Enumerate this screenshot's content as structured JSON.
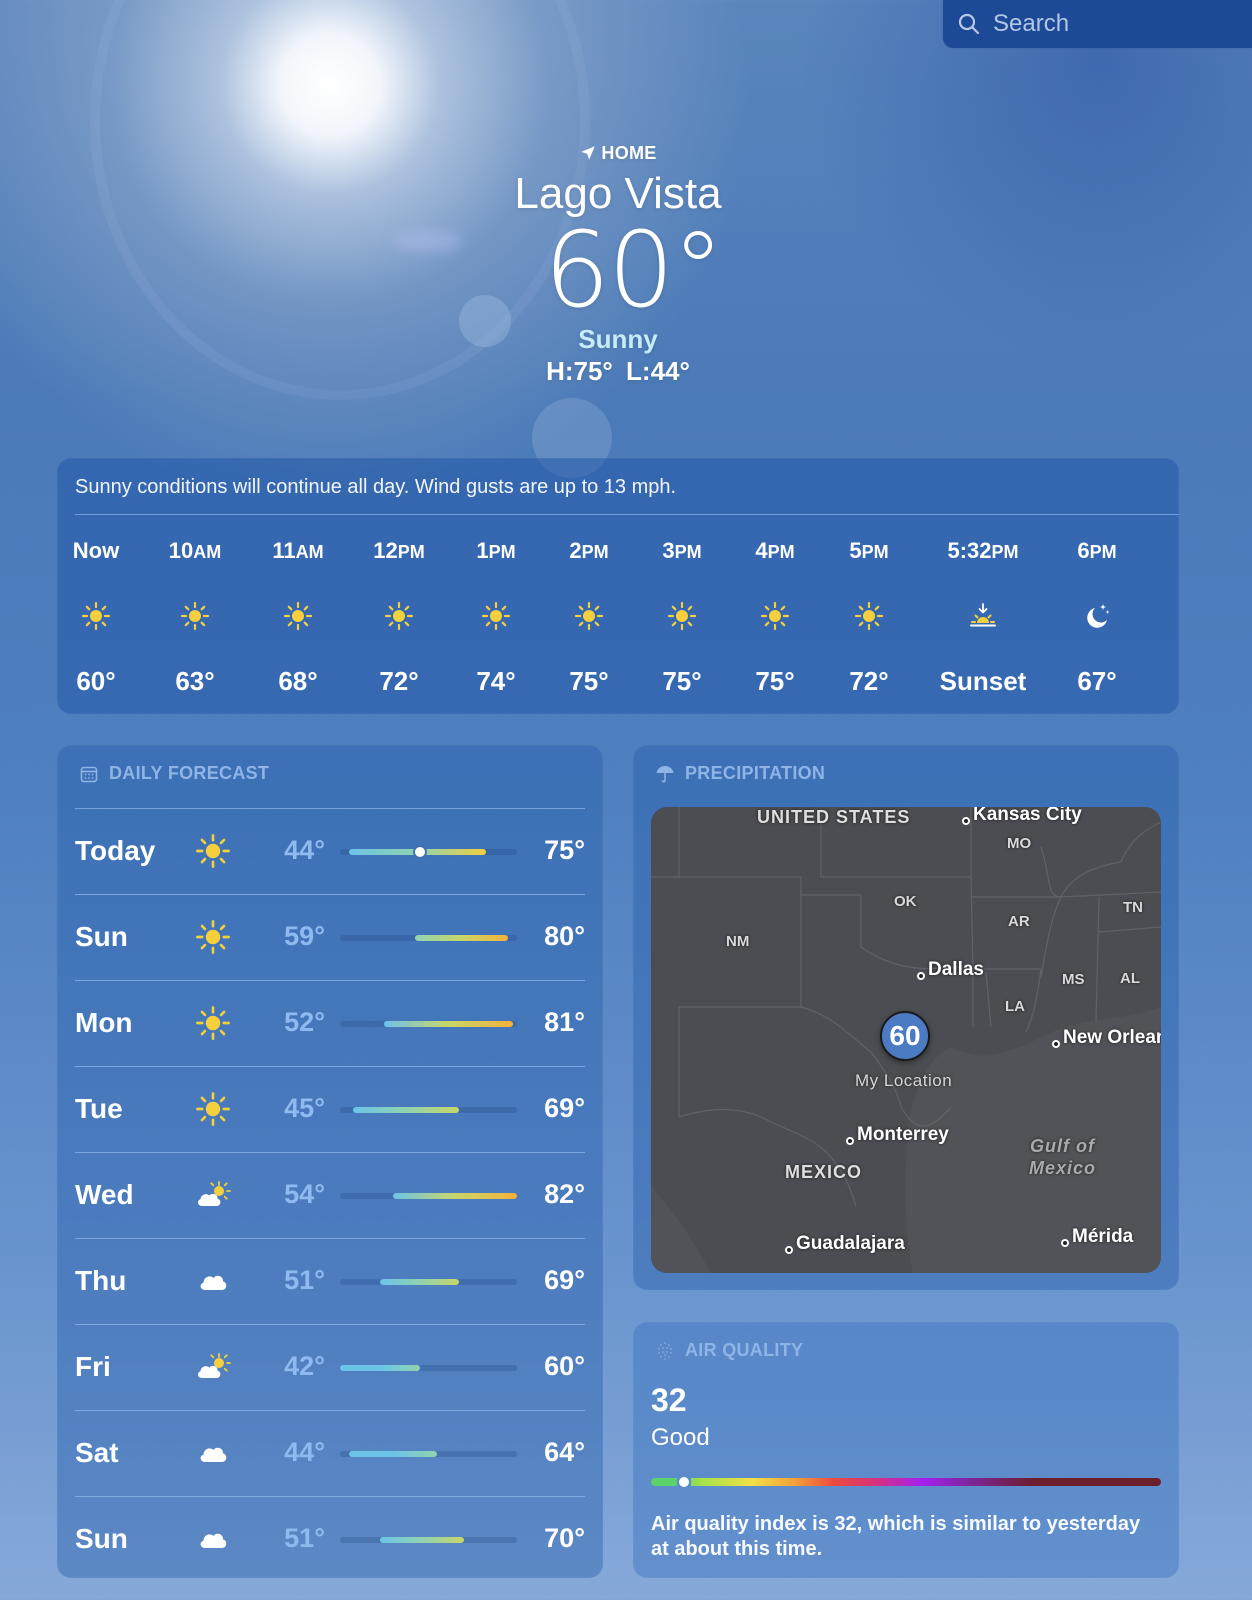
{
  "search": {
    "placeholder": "Search"
  },
  "header": {
    "home_label": "HOME",
    "city": "Lago Vista",
    "temperature": "60°",
    "condition": "Sunny",
    "high_low": "H:75°  L:44°"
  },
  "hourly": {
    "summary": "Sunny conditions will continue all day. Wind gusts are up to 13 mph.",
    "hours": [
      {
        "time": "Now",
        "suffix": "",
        "icon": "sun-icon",
        "value": "60°"
      },
      {
        "time": "10",
        "suffix": "AM",
        "icon": "sun-icon",
        "value": "63°"
      },
      {
        "time": "11",
        "suffix": "AM",
        "icon": "sun-icon",
        "value": "68°"
      },
      {
        "time": "12",
        "suffix": "PM",
        "icon": "sun-icon",
        "value": "72°"
      },
      {
        "time": "1",
        "suffix": "PM",
        "icon": "sun-icon",
        "value": "74°"
      },
      {
        "time": "2",
        "suffix": "PM",
        "icon": "sun-icon",
        "value": "75°"
      },
      {
        "time": "3",
        "suffix": "PM",
        "icon": "sun-icon",
        "value": "75°"
      },
      {
        "time": "4",
        "suffix": "PM",
        "icon": "sun-icon",
        "value": "75°"
      },
      {
        "time": "5",
        "suffix": "PM",
        "icon": "sun-icon",
        "value": "72°"
      },
      {
        "time": "5:32",
        "suffix": "PM",
        "icon": "sunset-icon",
        "value": "Sunset"
      },
      {
        "time": "6",
        "suffix": "PM",
        "icon": "moon-stars-icon",
        "value": "67°"
      }
    ]
  },
  "daily": {
    "title": "DAILY FORECAST",
    "range_min": 42,
    "range_max": 82,
    "current_temp": 60,
    "days": [
      {
        "day": "Today",
        "icon": "sun-icon",
        "low": 44,
        "high": 75,
        "low_label": "44°",
        "high_label": "75°"
      },
      {
        "day": "Sun",
        "icon": "sun-icon",
        "low": 59,
        "high": 80,
        "low_label": "59°",
        "high_label": "80°"
      },
      {
        "day": "Mon",
        "icon": "sun-icon",
        "low": 52,
        "high": 81,
        "low_label": "52°",
        "high_label": "81°"
      },
      {
        "day": "Tue",
        "icon": "sun-icon",
        "low": 45,
        "high": 69,
        "low_label": "45°",
        "high_label": "69°"
      },
      {
        "day": "Wed",
        "icon": "partly-cloudy-icon",
        "low": 54,
        "high": 82,
        "low_label": "54°",
        "high_label": "82°"
      },
      {
        "day": "Thu",
        "icon": "cloud-icon",
        "low": 51,
        "high": 69,
        "low_label": "51°",
        "high_label": "69°"
      },
      {
        "day": "Fri",
        "icon": "partly-cloudy-icon",
        "low": 42,
        "high": 60,
        "low_label": "42°",
        "high_label": "60°"
      },
      {
        "day": "Sat",
        "icon": "cloud-icon",
        "low": 44,
        "high": 64,
        "low_label": "44°",
        "high_label": "64°"
      },
      {
        "day": "Sun",
        "icon": "cloud-icon",
        "low": 51,
        "high": 70,
        "low_label": "51°",
        "high_label": "70°"
      }
    ]
  },
  "precipitation": {
    "title": "PRECIPITATION",
    "map": {
      "countries": [
        "UNITED STATES",
        "MEXICO"
      ],
      "states": [
        "MO",
        "OK",
        "AR",
        "TN",
        "NM",
        "MS",
        "AL",
        "LA"
      ],
      "cities": [
        "Kansas City",
        "Dallas",
        "New Orleans",
        "Monterrey",
        "Guadalajara",
        "Mérida"
      ],
      "water": [
        "Gulf of",
        "Mexico"
      ],
      "pin_value": "60",
      "pin_label": "My Location"
    }
  },
  "air_quality": {
    "title": "AIR QUALITY",
    "value": "32",
    "category": "Good",
    "scale_position": 0.064,
    "description": "Air quality index is 32, which is similar to yesterday at about this time."
  },
  "colors": {
    "sun": "#f5d03c",
    "low_temp": "#8fbaf0",
    "section_header": "#8fb4e6",
    "condition": "#c6ecf7"
  }
}
